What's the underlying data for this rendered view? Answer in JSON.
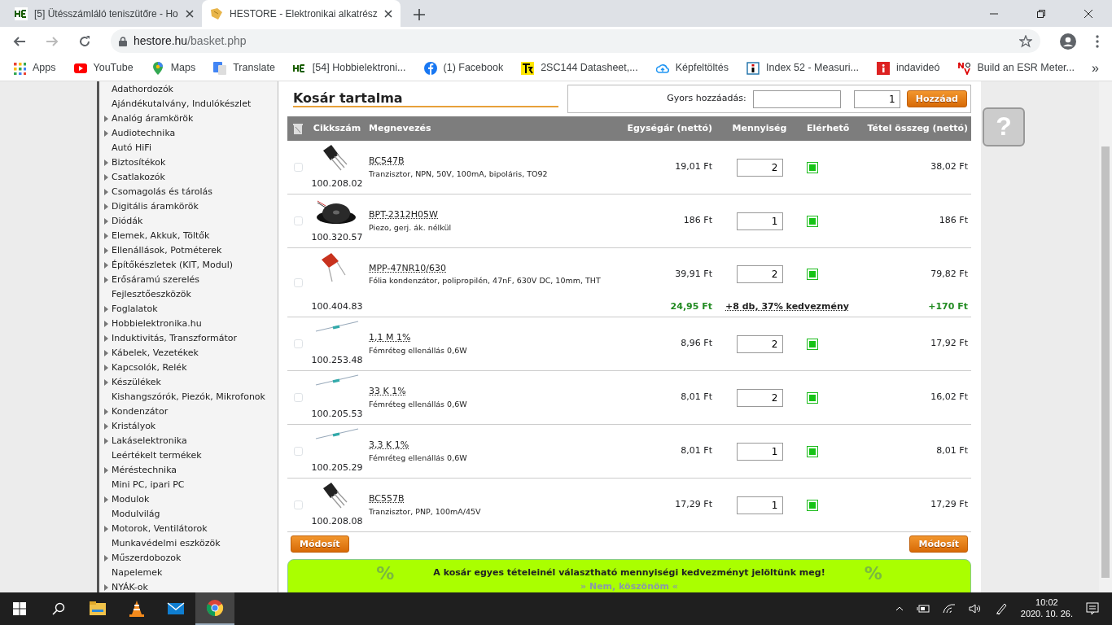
{
  "browser": {
    "tabs": [
      {
        "title": "[5] Ütésszámláló teniszütőre - Ho",
        "selected": false
      },
      {
        "title": "HESTORE - Elektronikai alkatrész",
        "selected": true
      }
    ],
    "url_host": "hestore.hu",
    "url_path": "/basket.php",
    "bookmarks": [
      {
        "label": "Apps"
      },
      {
        "label": "YouTube"
      },
      {
        "label": "Maps"
      },
      {
        "label": "Translate"
      },
      {
        "label": "[54] Hobbielektroni..."
      },
      {
        "label": "(1) Facebook"
      },
      {
        "label": "2SC144 Datasheet,..."
      },
      {
        "label": "Képfeltöltés"
      },
      {
        "label": "Index 52 - Measuri..."
      },
      {
        "label": "indavideó"
      },
      {
        "label": "Build an ESR Meter..."
      }
    ],
    "bookmarks_more": "»"
  },
  "sidebar": {
    "items": [
      {
        "label": "Adathordozók",
        "expandable": false
      },
      {
        "label": "Ajándékutalvány, Indulókészlet",
        "expandable": false
      },
      {
        "label": "Analóg áramkörök",
        "expandable": true
      },
      {
        "label": "Audiotechnika",
        "expandable": true
      },
      {
        "label": "Autó HiFi",
        "expandable": false
      },
      {
        "label": "Biztosítékok",
        "expandable": true
      },
      {
        "label": "Csatlakozók",
        "expandable": true
      },
      {
        "label": "Csomagolás és tárolás",
        "expandable": true
      },
      {
        "label": "Digitális áramkörök",
        "expandable": true
      },
      {
        "label": "Diódák",
        "expandable": true
      },
      {
        "label": "Elemek, Akkuk, Töltők",
        "expandable": true
      },
      {
        "label": "Ellenállások, Potméterek",
        "expandable": true
      },
      {
        "label": "Építőkészletek (KIT, Modul)",
        "expandable": true
      },
      {
        "label": "Erősáramú szerelés",
        "expandable": true
      },
      {
        "label": "Fejlesztőeszközök",
        "expandable": false
      },
      {
        "label": "Foglalatok",
        "expandable": true
      },
      {
        "label": "Hobbielektronika.hu",
        "expandable": true
      },
      {
        "label": "Induktivitás, Transzformátor",
        "expandable": true
      },
      {
        "label": "Kábelek, Vezetékek",
        "expandable": true
      },
      {
        "label": "Kapcsolók, Relék",
        "expandable": true
      },
      {
        "label": "Készülékek",
        "expandable": true
      },
      {
        "label": "Kishangszórók, Piezók, Mikrofonok",
        "expandable": false
      },
      {
        "label": "Kondenzátor",
        "expandable": true
      },
      {
        "label": "Kristályok",
        "expandable": true
      },
      {
        "label": "Lakáselektronika",
        "expandable": true
      },
      {
        "label": "Leértékelt termékek",
        "expandable": false
      },
      {
        "label": "Méréstechnika",
        "expandable": true
      },
      {
        "label": "Mini PC, ipari PC",
        "expandable": false
      },
      {
        "label": "Modulok",
        "expandable": true
      },
      {
        "label": "Modulvilág",
        "expandable": false
      },
      {
        "label": "Motorok, Ventilátorok",
        "expandable": true
      },
      {
        "label": "Munkavédelmi eszközök",
        "expandable": false
      },
      {
        "label": "Műszerdobozok",
        "expandable": true
      },
      {
        "label": "Napelemek",
        "expandable": false
      },
      {
        "label": "NYÁK-ok",
        "expandable": true
      }
    ]
  },
  "basket": {
    "title": "Kosár tartalma",
    "quick_add": {
      "label": "Gyors hozzáadás:",
      "quantity": "1",
      "button": "Hozzáad"
    },
    "columns": [
      "Cikkszám",
      "Megnevezés",
      "Egységár (nettó)",
      "Mennyiség",
      "Elérhető",
      "Tétel összeg (nettó)"
    ],
    "rows": [
      {
        "code": "100.208.02",
        "name": "BC547B",
        "description": "Tranzisztor, NPN, 50V, 100mA, bipoláris, TO92",
        "unit_price": "19,01 Ft",
        "quantity": "2",
        "available": true,
        "total": "38,02 Ft",
        "checked": false,
        "kind": "transistor"
      },
      {
        "code": "100.320.57",
        "name": "BPT-2312H05W",
        "description": "Piezo, gerj. ák. nélkül",
        "unit_price": "186 Ft",
        "quantity": "1",
        "available": true,
        "total": "186 Ft",
        "checked": false,
        "kind": "buzzer"
      },
      {
        "code": "100.404.83",
        "name": "MPP-47NR10/630",
        "description": "Fólia kondenzátor, polipropilén, 47nF, 630V DC, 10mm, THT",
        "unit_price": "39,91 Ft",
        "quantity": "2",
        "available": true,
        "total": "79,82 Ft",
        "checked": false,
        "kind": "capacitor",
        "discount": {
          "unit_price": "24,95 Ft",
          "offer": "+8 db, 37% kedvezmény",
          "saving": "+170 Ft"
        }
      },
      {
        "code": "100.253.48",
        "name": "1,1 M 1%",
        "description": "Fémréteg ellenállás 0,6W",
        "unit_price": "8,96 Ft",
        "quantity": "2",
        "available": true,
        "total": "17,92 Ft",
        "checked": false,
        "kind": "resistor"
      },
      {
        "code": "100.205.53",
        "name": "33 K 1%",
        "description": "Fémréteg ellenállás 0,6W",
        "unit_price": "8,01 Ft",
        "quantity": "2",
        "available": true,
        "total": "16,02 Ft",
        "checked": false,
        "kind": "resistor"
      },
      {
        "code": "100.205.29",
        "name": "3,3 K 1%",
        "description": "Fémréteg ellenállás 0,6W",
        "unit_price": "8,01 Ft",
        "quantity": "1",
        "available": true,
        "total": "8,01 Ft",
        "checked": false,
        "kind": "resistor"
      },
      {
        "code": "100.208.08",
        "name": "BC557B",
        "description": "Tranzisztor, PNP, 100mA/45V",
        "unit_price": "17,29 Ft",
        "quantity": "1",
        "available": true,
        "total": "17,29 Ft",
        "checked": false,
        "kind": "transistor"
      }
    ],
    "buttons": [
      "Módosít",
      "Módosít"
    ],
    "banner": {
      "mark_left": "%",
      "text": "A kosár egyes tételeinél választható mennyiségi kedvezményt jelöltünk meg!",
      "mark_right": "%",
      "link": "» Nem, köszönöm «"
    }
  },
  "help_button": "?",
  "taskbar": {
    "apps": [
      {
        "kind": "explorer",
        "active": false
      },
      {
        "kind": "vlc",
        "active": false
      },
      {
        "kind": "mail",
        "active": false
      },
      {
        "kind": "chrome",
        "active": true
      }
    ],
    "time": "10:02",
    "date": "2020. 10. 26."
  }
}
